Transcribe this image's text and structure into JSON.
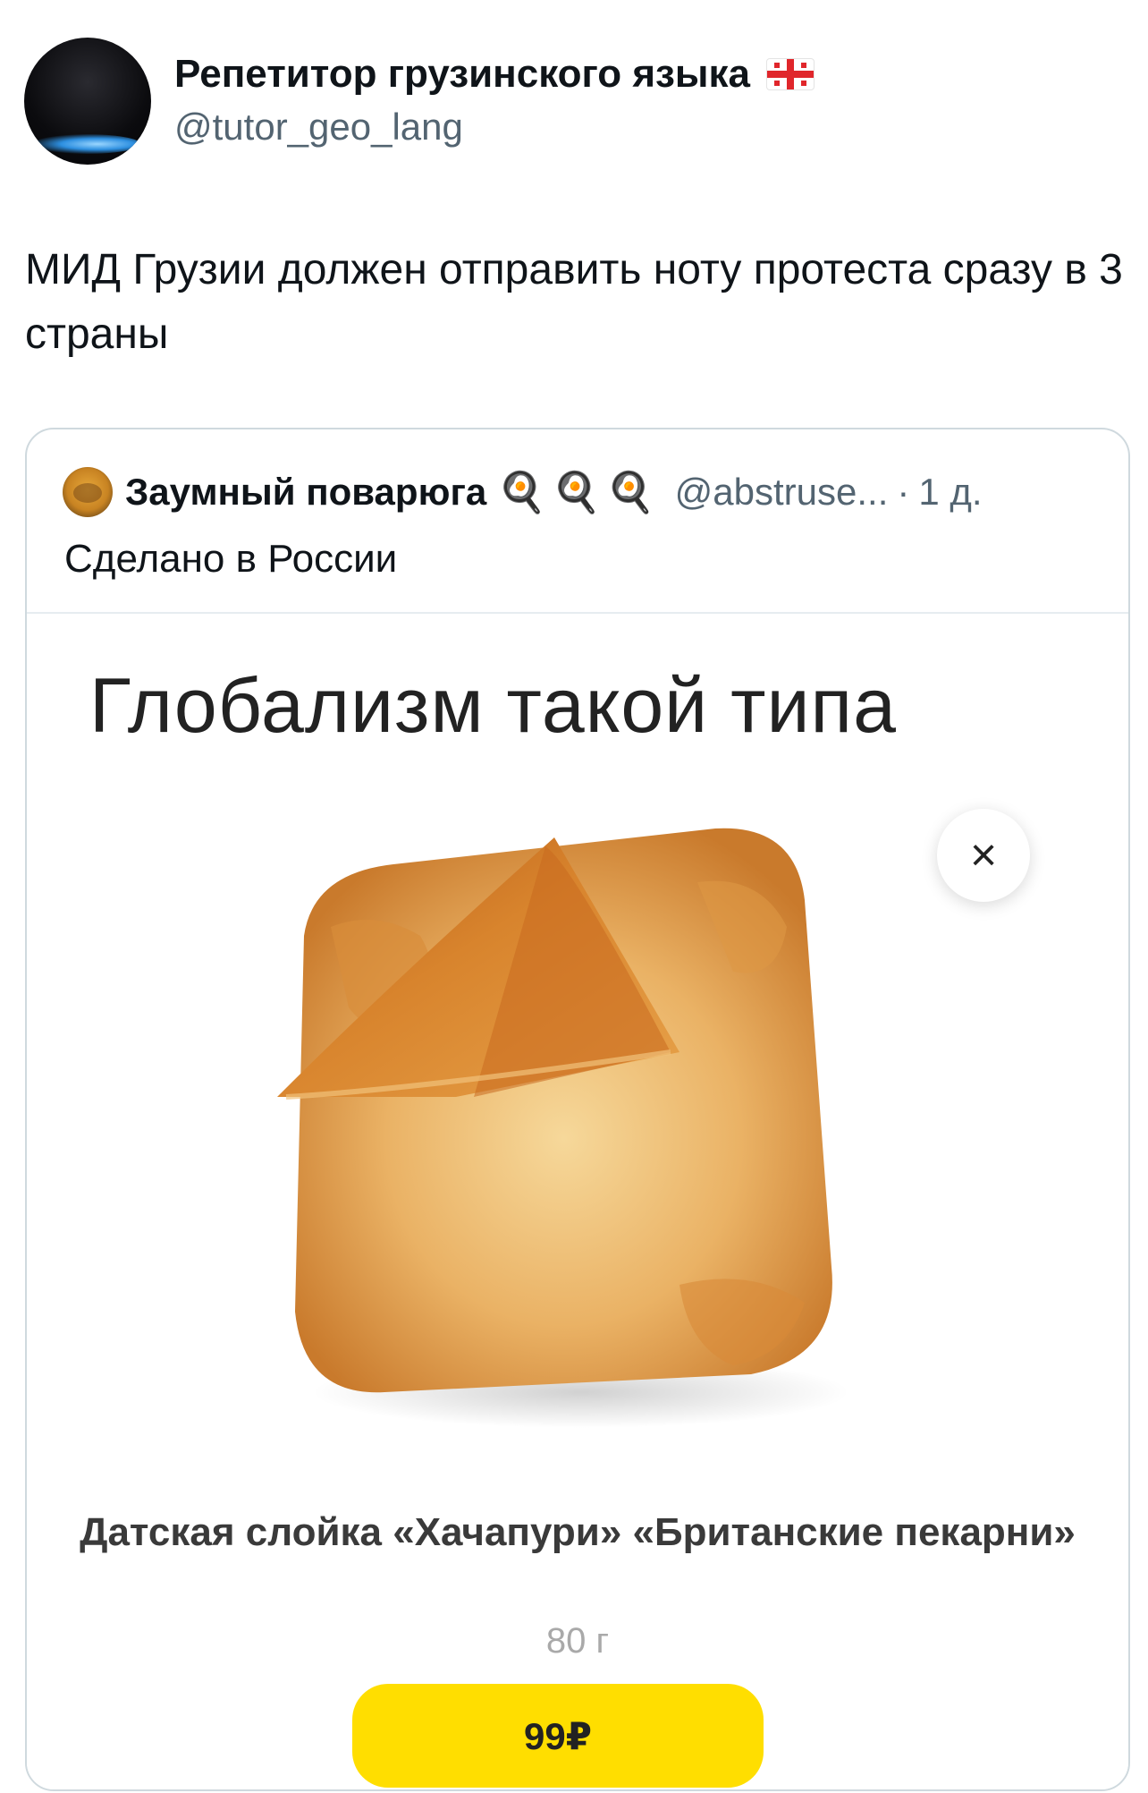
{
  "author": {
    "name": "Репетитор грузинского языка",
    "flag_icon": "georgia-flag-icon",
    "handle": "@tutor_geo_lang"
  },
  "tweet": {
    "text": "МИД Грузии должен отправить ноту протеста сразу в 3 страны"
  },
  "quote": {
    "name": "Заумный поварюга",
    "emojis": "🍳🍳🍳",
    "handle": "@abstruse...",
    "separator": "·",
    "time": "1 д.",
    "text": "Сделано в России",
    "media": {
      "title": "Глобализм такой типа",
      "close_label": "×",
      "product_name": "Датская слойка «Хачапури» «Британские пекарни»",
      "weight": "80 г",
      "price": "99₽",
      "colors": {
        "price_button": "#ffde00"
      }
    }
  },
  "colors": {
    "text": "#0f1419",
    "secondary": "#536471",
    "border": "#cfd9de"
  }
}
